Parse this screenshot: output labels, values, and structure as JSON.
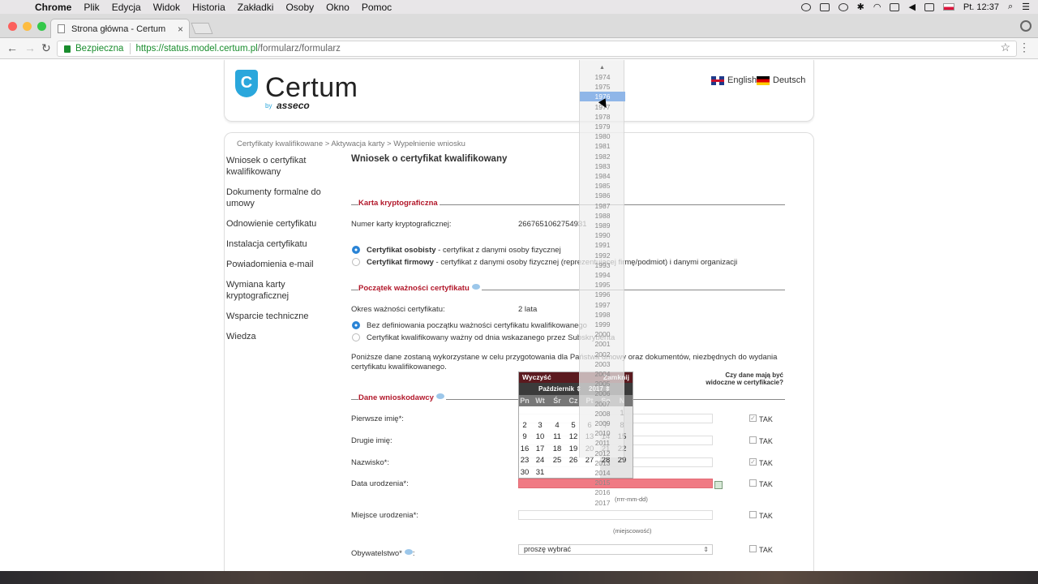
{
  "menubar": {
    "app": "Chrome",
    "items": [
      "Plik",
      "Edycja",
      "Widok",
      "Historia",
      "Zakładki",
      "Osoby",
      "Okno",
      "Pomoc"
    ],
    "clock": "Pt. 12:37"
  },
  "browser": {
    "tab_title": "Strona główna - Certum",
    "secure_label": "Bezpieczna",
    "url_host": "https://status.model.certum.pl",
    "url_path": "/formularz/formularz"
  },
  "header": {
    "logo_text": "Certum",
    "logo_by": "by",
    "logo_asseco": "asseco",
    "lang_en": "English",
    "lang_de": "Deutsch"
  },
  "breadcrumb": "Certyfikaty kwalifikowane > Aktywacja karty > Wypełnienie wniosku",
  "sidebar": [
    "Wniosek o certyfikat kwalifikowany",
    "Dokumenty formalne do umowy",
    "Odnowienie certyfikatu",
    "Instalacja certyfikatu",
    "Powiadomienia e-mail",
    "Wymiana karty kryptograficznej",
    "Wsparcie techniczne",
    "Wiedza"
  ],
  "form": {
    "title": "Wniosek o certyfikat kwalifikowany",
    "section_card": "Karta kryptograficzna",
    "card_number_label": "Numer karty kryptograficznej:",
    "card_number": "2667651062754931",
    "radio_personal_bold": "Certyfikat osobisty",
    "radio_personal_rest": " - certyfikat z danymi osoby fizycznej",
    "radio_company_bold": "Certyfikat firmowy",
    "radio_company_rest": " - certyfikat z danymi osoby fizycznej (reprezentującej firmę/podmiot) i danymi organizacji",
    "section_validity": "Początek ważności certyfikatu",
    "validity_label": "Okres ważności certyfikatu:",
    "validity_value": "2 lata",
    "radio_nodef": "Bez definiowania początku ważności certyfikatu kwalifikowanego",
    "radio_fromdate": "Certyfikat kwalifikowany ważny od dnia wskazanego przez Subskrybenta",
    "note": "Poniższe dane zostaną wykorzystane w celu przygotowania dla Państwa umowy oraz dokumentów, niezbędnych do wydania certyfikatu kwalifikowanego.",
    "visible_question": "Czy dane mają być widoczne w certyfikacie?",
    "section_applicant": "Dane wnioskodawcy",
    "first_name_label": "Pierwsze imię*:",
    "second_name_label": "Drugie imię:",
    "surname_label": "Nazwisko*:",
    "birth_date_label": "Data urodzenia*:",
    "birth_date_hint": "(rrrr-mm-dd)",
    "birth_place_label": "Miejsce urodzenia*:",
    "birth_place_hint": "(miejscowość)",
    "citizenship_label": "Obywatelstwo*",
    "citizenship_suffix": ":",
    "citizenship_value": "proszę wybrać",
    "tak": "TAK",
    "checked_mark": "✓"
  },
  "calendar": {
    "clear": "Wyczyść",
    "close": "Zamknij",
    "month": "Październik",
    "year": "2017",
    "day_headers": [
      "Pn",
      "Wt",
      "Śr",
      "Cz",
      "Pt",
      "So",
      "N"
    ],
    "weeks": [
      [
        "",
        "",
        "",
        "",
        "",
        "",
        "1"
      ],
      [
        "2",
        "3",
        "4",
        "5",
        "6",
        "7",
        "8"
      ],
      [
        "9",
        "10",
        "11",
        "12",
        "13",
        "14",
        "15"
      ],
      [
        "16",
        "17",
        "18",
        "19",
        "20",
        "21",
        "22"
      ],
      [
        "23",
        "24",
        "25",
        "26",
        "27",
        "28",
        "29"
      ],
      [
        "30",
        "31",
        "",
        "",
        "",
        "",
        ""
      ]
    ]
  },
  "year_list": {
    "years": [
      "1974",
      "1975",
      "1976",
      "1977",
      "1978",
      "1979",
      "1980",
      "1981",
      "1982",
      "1983",
      "1984",
      "1985",
      "1986",
      "1987",
      "1988",
      "1989",
      "1990",
      "1991",
      "1992",
      "1993",
      "1994",
      "1995",
      "1996",
      "1997",
      "1998",
      "1999",
      "2000",
      "2001",
      "2002",
      "2003",
      "2004",
      "2005",
      "2006",
      "2007",
      "2008",
      "2009",
      "2010",
      "2011",
      "2012",
      "2013",
      "2014",
      "2015",
      "2016",
      "2017"
    ],
    "highlighted": "1976"
  }
}
